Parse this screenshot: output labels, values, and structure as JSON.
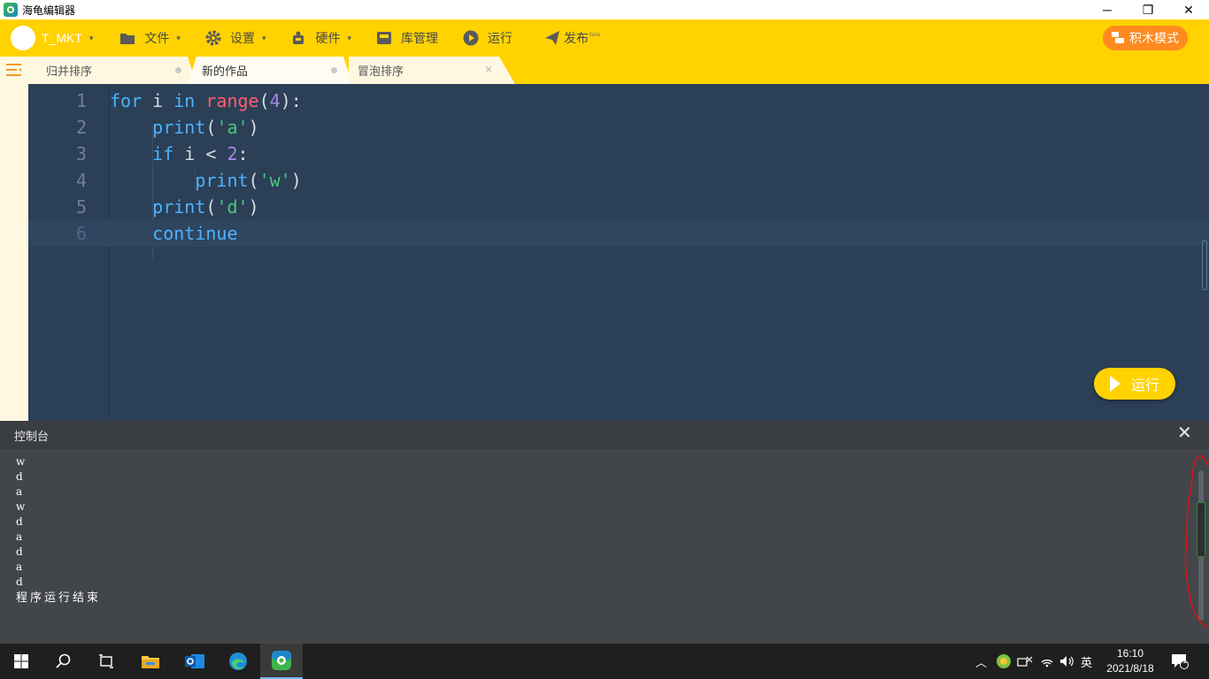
{
  "window": {
    "title": "海龟编辑器",
    "minimize": "─",
    "restore": "❐",
    "close": "✕"
  },
  "menubar": {
    "user": "T_MKT",
    "file": "文件",
    "settings": "设置",
    "hardware": "硬件",
    "library": "库管理",
    "run": "运行",
    "publish": "发布",
    "publish_badge": "Beta",
    "block_mode": "积木模式",
    "caret": "▾"
  },
  "tabs": [
    {
      "label": "归并排序"
    },
    {
      "label": "新的作品"
    },
    {
      "label": "冒泡排序",
      "close": "×"
    }
  ],
  "code": {
    "line_numbers": [
      "1",
      "2",
      "3",
      "4",
      "5",
      "6"
    ],
    "l1": {
      "kw1": "for",
      "var": " i ",
      "kw2": "in",
      "fn": " range",
      "p1": "(",
      "num": "4",
      "p2": "):"
    },
    "l2": {
      "indent": "    ",
      "fn": "print",
      "p1": "(",
      "str": "'a'",
      "p2": ")"
    },
    "l3": {
      "indent": "    ",
      "kw": "if",
      "rest": " i < ",
      "num": "2",
      "colon": ":"
    },
    "l4": {
      "indent": "        ",
      "fn": "print",
      "p1": "(",
      "str": "'w'",
      "p2": ")"
    },
    "l5": {
      "indent": "    ",
      "fn": "print",
      "p1": "(",
      "str": "'d'",
      "p2": ")"
    },
    "l6": {
      "indent": "    ",
      "kw": "continue"
    }
  },
  "run_button": "运行",
  "console": {
    "title": "控制台",
    "close": "✕",
    "output": [
      "w",
      "d",
      "a",
      "w",
      "d",
      "a",
      "d",
      "a",
      "d"
    ],
    "end_message": "程序运行结束"
  },
  "taskbar": {
    "tray_chevron": "︿",
    "ime": "英",
    "time": "16:10",
    "date": "2021/8/18",
    "notification_count": "1"
  }
}
